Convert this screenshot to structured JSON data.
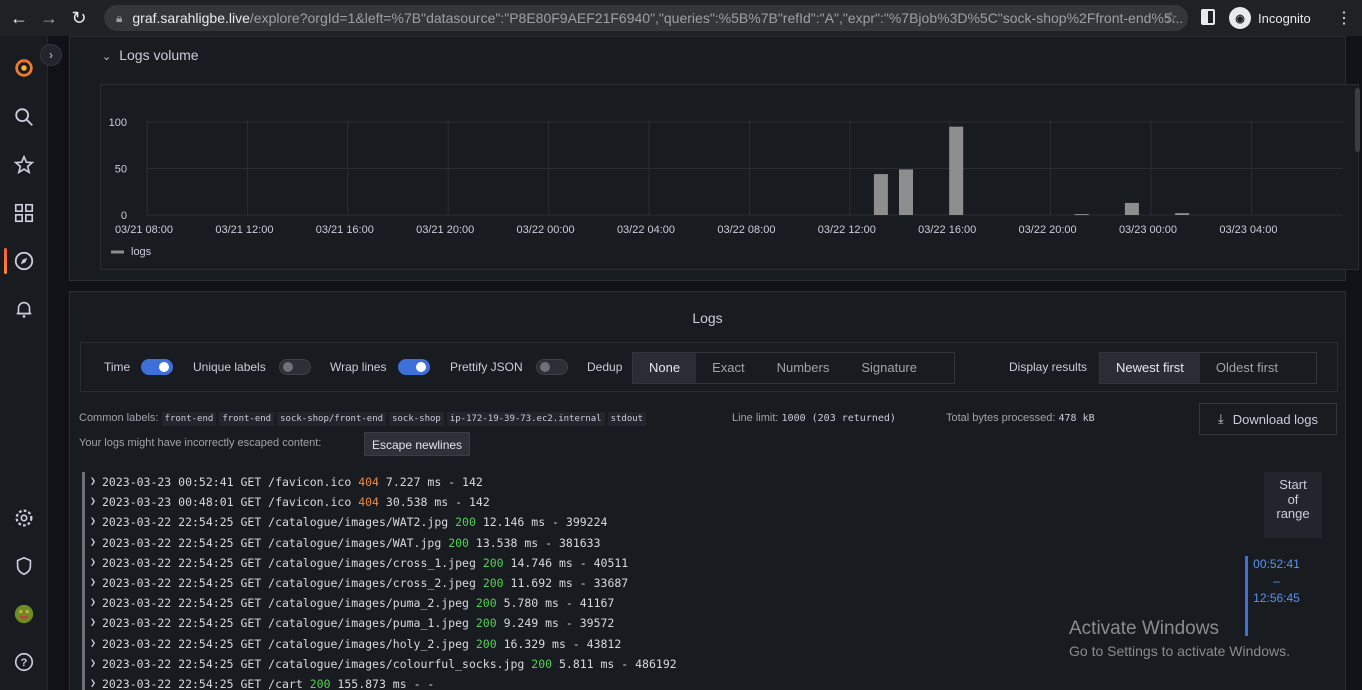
{
  "browser": {
    "url_host": "graf.sarahligbe.live",
    "url_path": "/explore?orgId=1&left=%7B\"datasource\":\"P8E80F9AEF21F6940\",\"queries\":%5B%7B\"refId\":\"A\",\"expr\":\"%7Bjob%3D%5C\"sock-shop%2Ffront-end%5...",
    "profile_label": "Incognito"
  },
  "logs_volume": {
    "title": "Logs volume",
    "legend": "logs"
  },
  "chart_data": {
    "type": "bar",
    "yticks": [
      "100",
      "50",
      "0"
    ],
    "ylim": [
      0,
      110
    ],
    "xticks": [
      "03/21 08:00",
      "03/21 12:00",
      "03/21 16:00",
      "03/21 20:00",
      "03/22 00:00",
      "03/22 04:00",
      "03/22 08:00",
      "03/22 12:00",
      "03/22 16:00",
      "03/22 20:00",
      "03/23 00:00",
      "03/23 04:00"
    ],
    "series": [
      {
        "name": "logs",
        "points": [
          {
            "x": "03/22 13:00",
            "y": 44
          },
          {
            "x": "03/22 14:00",
            "y": 49
          },
          {
            "x": "03/22 16:00",
            "y": 95
          },
          {
            "x": "03/22 21:00",
            "y": 1
          },
          {
            "x": "03/22 23:00",
            "y": 13
          },
          {
            "x": "03/23 01:00",
            "y": 2
          }
        ]
      }
    ],
    "grid": true,
    "legend_position": "bottom-left",
    "color": "#8e8e8e"
  },
  "logs": {
    "title": "Logs",
    "options": {
      "time": "Time",
      "unique_labels": "Unique labels",
      "wrap_lines": "Wrap lines",
      "prettify_json": "Prettify JSON",
      "dedup": "Dedup",
      "dedup_options": [
        "None",
        "Exact",
        "Numbers",
        "Signature"
      ],
      "display_results": "Display results",
      "order_options": [
        "Newest first",
        "Oldest first"
      ]
    },
    "common_labels_label": "Common labels:",
    "common_labels": [
      "front-end",
      "front-end",
      "sock-shop/front-end",
      "sock-shop",
      "ip-172-19-39-73.ec2.internal",
      "stdout"
    ],
    "line_limit_label": "Line limit:",
    "line_limit_value": "1000 (203 returned)",
    "total_bytes_label": "Total bytes processed:",
    "total_bytes_value": "478 kB",
    "escape_warning": "Your logs might have incorrectly escaped content:",
    "escape_button": "Escape newlines",
    "download_button": "Download logs",
    "start_of_range": [
      "Start",
      "of",
      "range"
    ],
    "range": [
      "00:52:41",
      "–",
      "12:56:45"
    ],
    "lines": [
      {
        "pre": "2023-03-23 00:52:41 GET /favicon.ico ",
        "status": "404",
        "post": " 7.227 ms - 142"
      },
      {
        "pre": "2023-03-23 00:48:01 GET /favicon.ico ",
        "status": "404",
        "post": " 30.538 ms - 142"
      },
      {
        "pre": "2023-03-22 22:54:25 GET /catalogue/images/WAT2.jpg ",
        "status": "200",
        "post": " 12.146 ms - 399224"
      },
      {
        "pre": "2023-03-22 22:54:25 GET /catalogue/images/WAT.jpg ",
        "status": "200",
        "post": " 13.538 ms - 381633"
      },
      {
        "pre": "2023-03-22 22:54:25 GET /catalogue/images/cross_1.jpeg ",
        "status": "200",
        "post": " 14.746 ms - 40511"
      },
      {
        "pre": "2023-03-22 22:54:25 GET /catalogue/images/cross_2.jpeg ",
        "status": "200",
        "post": " 11.692 ms - 33687"
      },
      {
        "pre": "2023-03-22 22:54:25 GET /catalogue/images/puma_2.jpeg ",
        "status": "200",
        "post": " 5.780 ms - 41167"
      },
      {
        "pre": "2023-03-22 22:54:25 GET /catalogue/images/puma_1.jpeg ",
        "status": "200",
        "post": " 9.249 ms - 39572"
      },
      {
        "pre": "2023-03-22 22:54:25 GET /catalogue/images/holy_2.jpeg ",
        "status": "200",
        "post": " 16.329 ms - 43812"
      },
      {
        "pre": "2023-03-22 22:54:25 GET /catalogue/images/colourful_socks.jpg ",
        "status": "200",
        "post": " 5.811 ms - 486192"
      },
      {
        "pre": "2023-03-22 22:54:25 GET /cart ",
        "status": "200",
        "post": " 155.873 ms - -"
      }
    ]
  },
  "watermark": {
    "line1": "Activate Windows",
    "line2": "Go to Settings to activate Windows."
  }
}
